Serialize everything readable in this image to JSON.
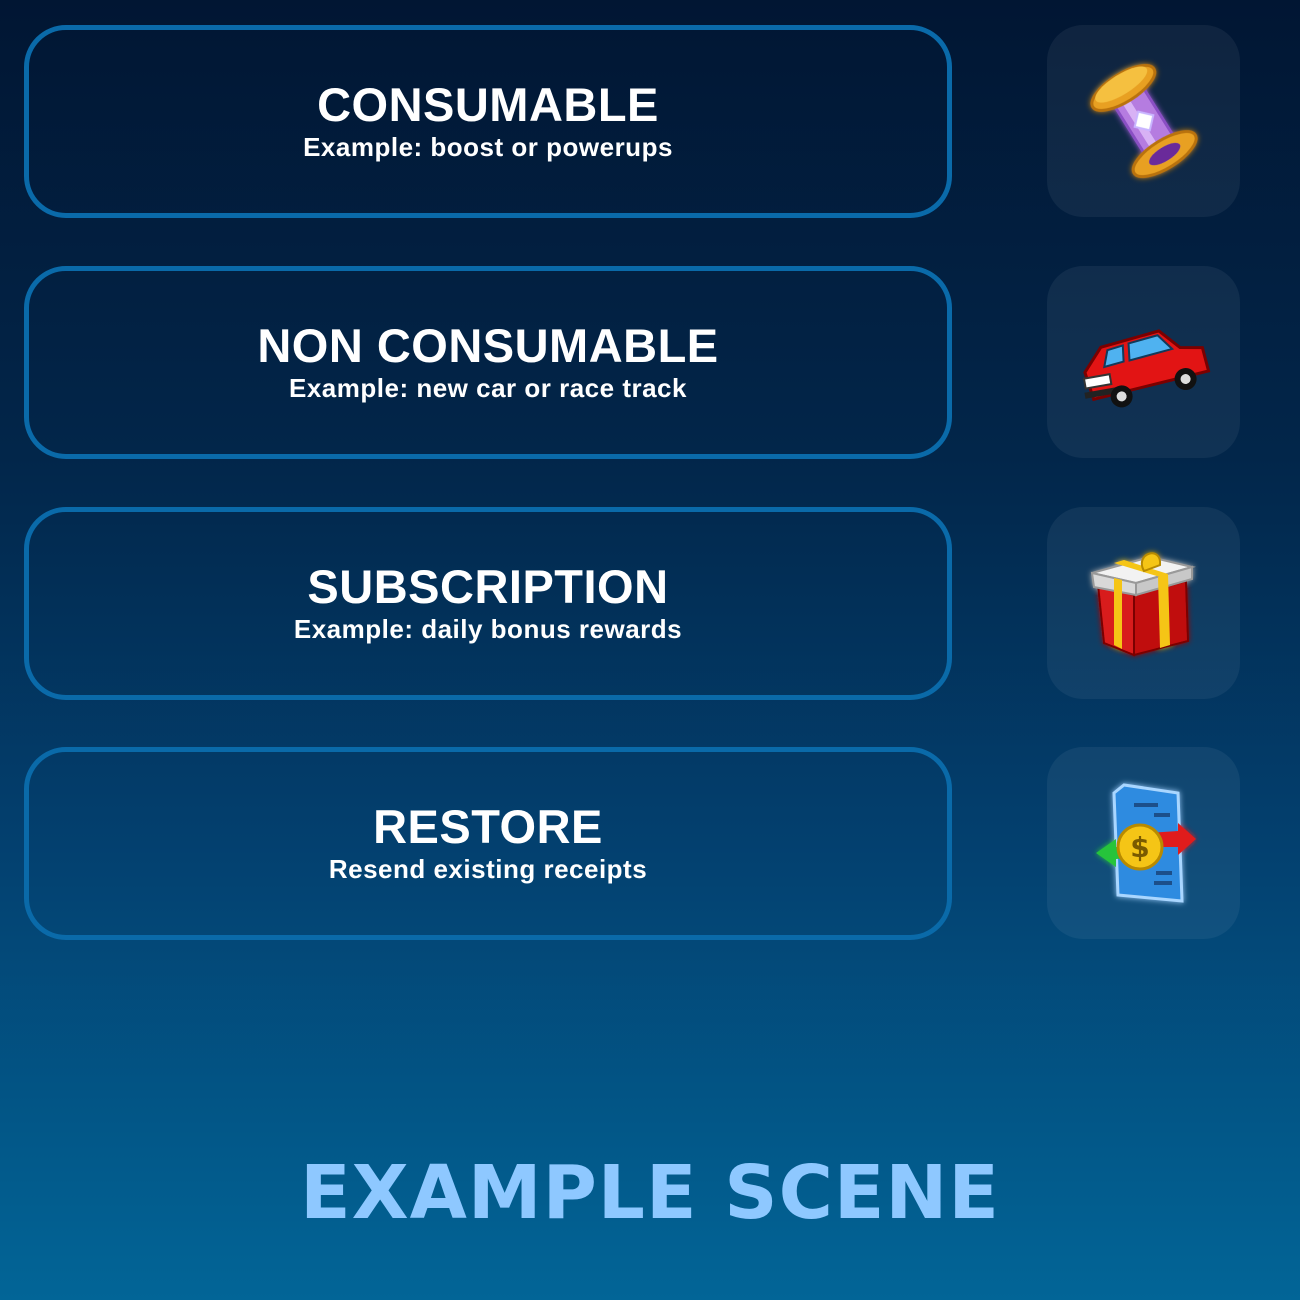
{
  "options": [
    {
      "title": "CONSUMABLE",
      "subtitle": "Example: boost or powerups",
      "icon": "powerup-icon"
    },
    {
      "title": "NON CONSUMABLE",
      "subtitle": "Example: new car or race track",
      "icon": "car-icon"
    },
    {
      "title": "SUBSCRIPTION",
      "subtitle": "Example: daily bonus rewards",
      "icon": "gift-icon"
    },
    {
      "title": "RESTORE",
      "subtitle": "Resend existing receipts",
      "icon": "receipt-restore-icon"
    }
  ],
  "footer": {
    "label": "EXAMPLE SCENE"
  },
  "colors": {
    "button_border": "#0a6aa9",
    "text": "#ffffff",
    "footer_text": "#8ec8ff",
    "background_top": "#011633",
    "background_bottom": "#026597"
  }
}
